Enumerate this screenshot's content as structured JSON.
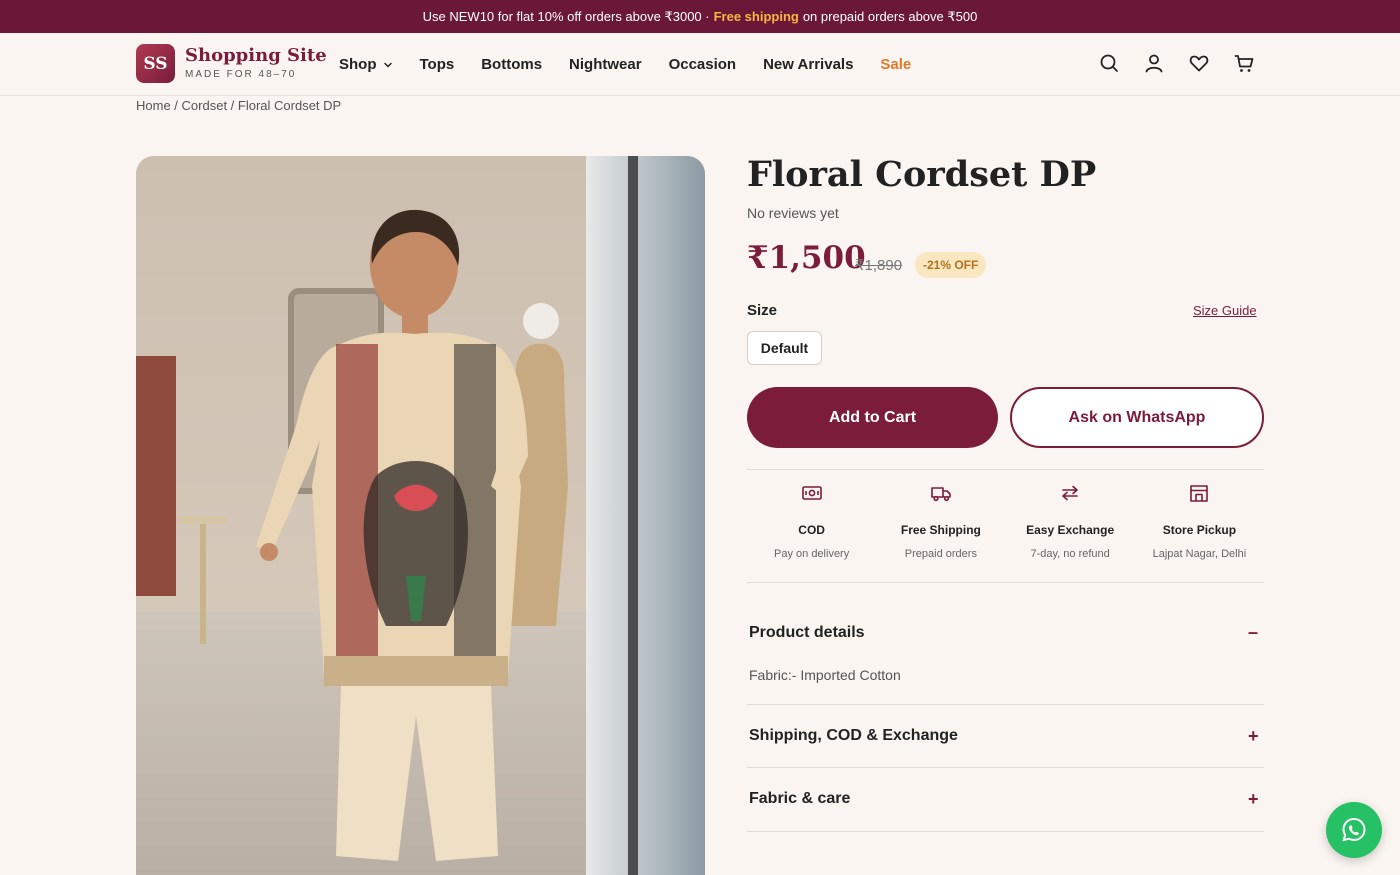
{
  "announcement": {
    "before": "Use NEW10 for flat 10% off orders above ₹3000 ·",
    "highlight": "Free shipping",
    "after": "on prepaid orders above ₹500"
  },
  "header": {
    "logo_badge": "SS",
    "logo_name": "Shopping Site",
    "logo_tag": "MADE FOR 48–70",
    "nav": [
      "Shop",
      "Tops",
      "Bottoms",
      "Nightwear",
      "Occasion",
      "New Arrivals",
      "Sale"
    ],
    "icons": [
      "search-icon",
      "account-icon",
      "wishlist-icon",
      "cart-icon"
    ]
  },
  "breadcrumb": [
    "Home",
    "Cordset",
    "Floral Cordset DP"
  ],
  "product": {
    "title": "Floral Cordset DP",
    "reviews": "No reviews yet",
    "price": "₹1,500",
    "old_price": "₹1,890",
    "discount": "-21% OFF",
    "size_label": "Size",
    "size_guide": "Size Guide",
    "size_option": "Default",
    "add_to_cart": "Add to Cart",
    "ask_whatsapp": "Ask on WhatsApp"
  },
  "features": [
    {
      "icon": "cash-icon",
      "title": "COD",
      "sub": "Pay on delivery"
    },
    {
      "icon": "truck-icon",
      "title": "Free Shipping",
      "sub": "Prepaid orders"
    },
    {
      "icon": "exchange-icon",
      "title": "Easy Exchange",
      "sub": "7-day, no refund"
    },
    {
      "icon": "store-icon",
      "title": "Store Pickup",
      "sub": "Lajpat Nagar, Delhi"
    }
  ],
  "accordion": [
    {
      "title": "Product details",
      "sign": "–",
      "body": "Fabric:- Imported Cotton"
    },
    {
      "title": "Shipping, COD & Exchange",
      "sign": "+"
    },
    {
      "title": "Fabric & care",
      "sign": "+"
    }
  ],
  "colors": {
    "brand": "#7a1c3a",
    "sale": "#e0772b",
    "whatsapp": "#25c164",
    "announce_bg": "#6b1838"
  }
}
